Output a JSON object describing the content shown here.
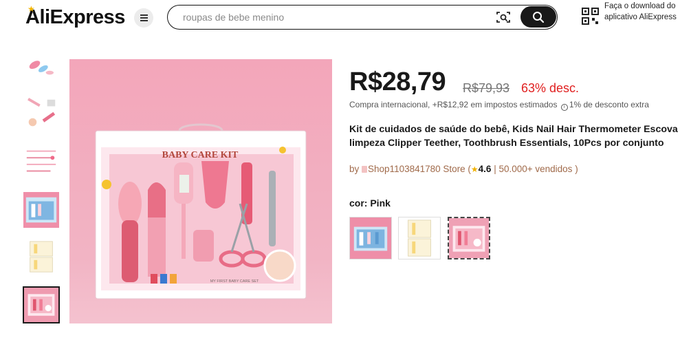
{
  "header": {
    "logo": "AliExpress",
    "search_placeholder": "roupas de bebe menino",
    "app_download": "Faça o download do aplicativo AliExpress"
  },
  "product": {
    "price": "R$28,79",
    "original_price": "R$79,93",
    "discount": "63% desc.",
    "international_prefix": "Compra internacional, +R$12,92 em impostos estimados",
    "extra_discount": "1% de desconto extra",
    "title_line1": "Kit de cuidados de saúde do bebê, Kids Nail Hair Thermometer Escova",
    "title_line2": "limpeza Clipper Teether, Toothbrush Essentials, 10Pcs por conjunto",
    "store_by": "by",
    "store_name": "Shop1103841780 Store",
    "rating": "4.6",
    "sold": "50.000+ vendidos",
    "color_label": "cor: Pink",
    "box_text": "BABY CARE KIT",
    "box_subtitle": "MY FIRST BABY CARE SET"
  },
  "colors": {
    "accent_dark": "#191919",
    "discount_red": "#e02020",
    "pink_bg": "#f2a7b9",
    "star": "#f0b000"
  },
  "icons": [
    "menu-icon",
    "camera-search-icon",
    "search-icon",
    "qr-code-icon",
    "info-icon",
    "shop-icon",
    "star-icon"
  ],
  "thumbnails_count": 7,
  "active_thumbnail": 7,
  "swatch_count": 3,
  "selected_swatch": 3
}
